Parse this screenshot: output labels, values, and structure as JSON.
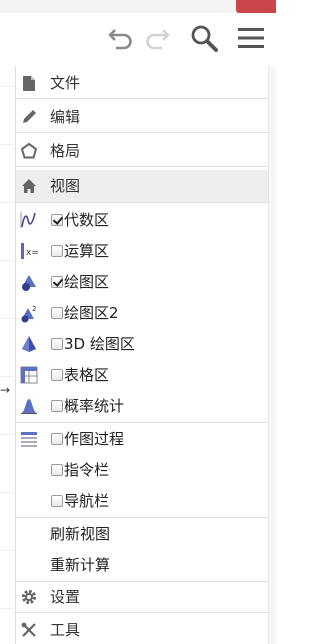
{
  "toolbar": {
    "undo_icon": "undo-icon",
    "redo_icon": "redo-icon",
    "search_icon": "search-icon",
    "menu_icon": "hamburger-menu-icon"
  },
  "menu": {
    "file": "文件",
    "edit": "编辑",
    "layout": "格局",
    "view": "视图",
    "view_items": [
      {
        "label": "代数区",
        "checked": true,
        "icon": "algebra-icon"
      },
      {
        "label": "运算区",
        "checked": false,
        "icon": "cas-icon"
      },
      {
        "label": "绘图区",
        "checked": true,
        "icon": "graphics-icon"
      },
      {
        "label": "绘图区2",
        "checked": false,
        "icon": "graphics2-icon"
      },
      {
        "label": "3D 绘图区",
        "checked": false,
        "icon": "graphics3d-icon"
      },
      {
        "label": "表格区",
        "checked": false,
        "icon": "spreadsheet-icon"
      },
      {
        "label": "概率统计",
        "checked": false,
        "icon": "probability-icon"
      },
      {
        "label": "作图过程",
        "checked": false,
        "icon": "construction-protocol-icon"
      },
      {
        "label": "指令栏",
        "checked": false
      },
      {
        "label": "导航栏",
        "checked": false
      }
    ],
    "refresh_views": "刷新视图",
    "recompute": "重新计算",
    "settings": "设置",
    "tools": "工具"
  },
  "canvas": {
    "axis_arrow": "→"
  }
}
